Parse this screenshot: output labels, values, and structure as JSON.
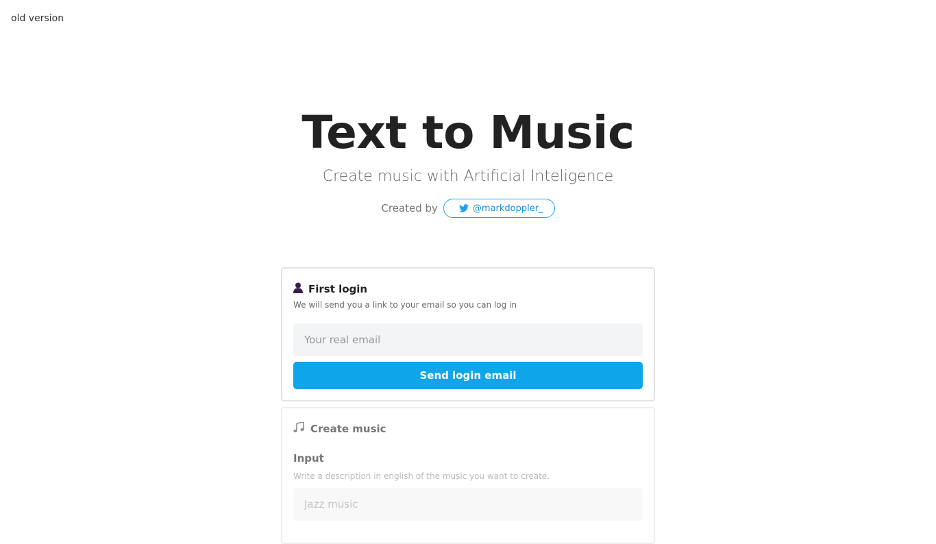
{
  "top_link": {
    "label": "old version"
  },
  "hero": {
    "title": "Text to Music",
    "subtitle": "Create music with Artificial Inteligence",
    "created_by_label": "Created by",
    "twitter_handle": "@markdoppler_",
    "twitter_icon": "twitter-bird-icon",
    "twitter_color": "#1da1f2"
  },
  "login_card": {
    "icon": "user-icon",
    "title": "First login",
    "description": "We will send you a link to your email so you can log in",
    "email_placeholder": "Your real email",
    "email_value": "",
    "button_label": "Send login email",
    "button_color": "#0ea5e9"
  },
  "music_card": {
    "icon": "music-notes-icon",
    "title": "Create music",
    "input_label": "Input",
    "input_help": "Write a description in english of the music you want to create.",
    "input_placeholder": "Jazz music",
    "input_value": ""
  }
}
